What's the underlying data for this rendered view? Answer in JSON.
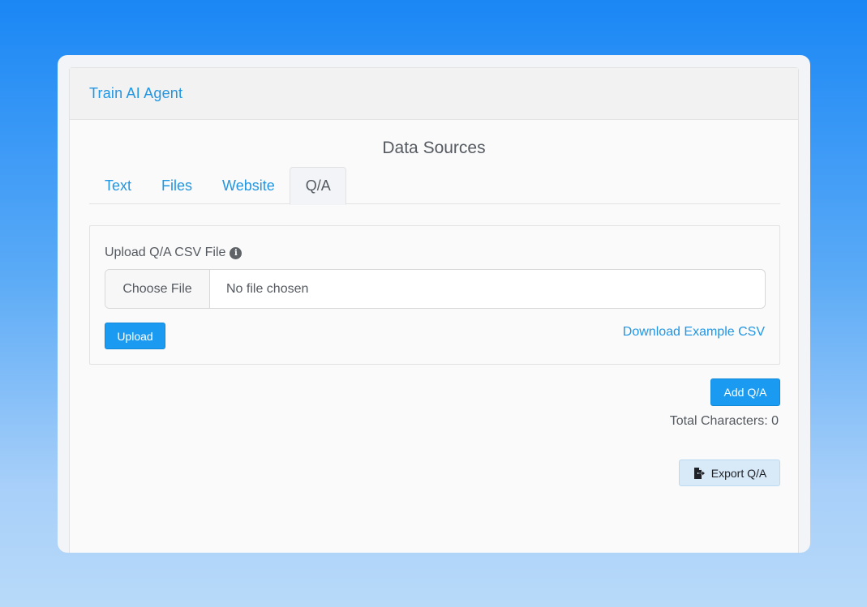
{
  "card": {
    "title": "Train AI Agent"
  },
  "section": {
    "title": "Data Sources"
  },
  "tabs": [
    {
      "label": "Text"
    },
    {
      "label": "Files"
    },
    {
      "label": "Website"
    },
    {
      "label": "Q/A",
      "active": true
    }
  ],
  "upload": {
    "label": "Upload Q/A CSV File",
    "info_icon": "info-icon",
    "choose_label": "Choose File",
    "file_status": "No file chosen",
    "upload_button": "Upload",
    "download_link": "Download Example CSV"
  },
  "actions": {
    "add_qa": "Add Q/A",
    "total_characters": "Total Characters: 0",
    "export_qa": "Export Q/A",
    "export_icon": "file-export-icon"
  },
  "colors": {
    "accent": "#2196e3",
    "primary_button": "#1a9af0",
    "export_button_bg": "#d8e9f8",
    "text": "#555a60"
  }
}
